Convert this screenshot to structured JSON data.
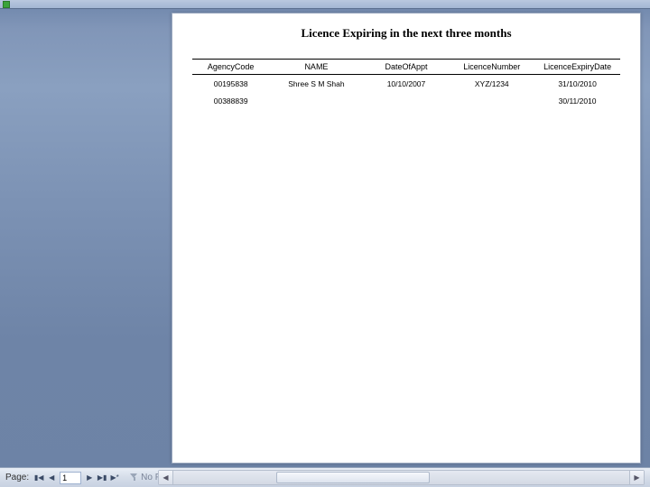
{
  "report": {
    "title": "Licence Expiring in the next three months",
    "columns": [
      "AgencyCode",
      "NAME",
      "DateOfAppt",
      "LicenceNumber",
      "LicenceExpiryDate"
    ],
    "rows": [
      {
        "agency_code": "00195838",
        "name": "Shree S M Shah",
        "date_of_appt": "10/10/2007",
        "licence_number": "XYZ/1234",
        "licence_expiry": "31/10/2010"
      },
      {
        "agency_code": "00388839",
        "name": "",
        "date_of_appt": "",
        "licence_number": "",
        "licence_expiry": "30/11/2010"
      }
    ]
  },
  "pager": {
    "label": "Page:",
    "current": "1",
    "filter_label": "No Filter"
  },
  "nav_glyphs": {
    "first": "▮◀",
    "prev": "◀",
    "next": "▶",
    "last": "▶▮",
    "new": "▶*"
  },
  "scroll_glyphs": {
    "left": "◀",
    "right": "▶"
  }
}
